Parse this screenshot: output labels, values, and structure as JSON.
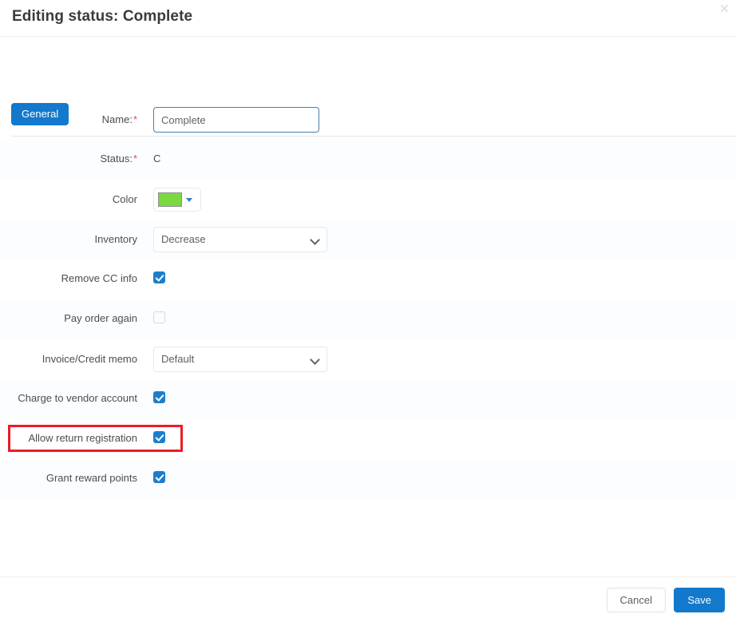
{
  "header": {
    "title": "Editing status: Complete",
    "close_label": "×"
  },
  "tabs": [
    {
      "label": "General",
      "active": true
    }
  ],
  "form": {
    "rows": [
      {
        "label": "Name:",
        "required": true,
        "type": "text",
        "value": "Complete",
        "placeholder": "Complete",
        "name": "name"
      },
      {
        "label": "Status:",
        "required": true,
        "type": "static",
        "value": "C",
        "name": "status"
      },
      {
        "label": "Color",
        "required": false,
        "type": "color",
        "value": "#7ad93f",
        "name": "color"
      },
      {
        "label": "Inventory",
        "required": false,
        "type": "select",
        "value": "Decrease",
        "name": "inventory"
      },
      {
        "label": "Remove CC info",
        "required": false,
        "type": "checkbox",
        "checked": true,
        "name": "remove-cc-info"
      },
      {
        "label": "Pay order again",
        "required": false,
        "type": "checkbox",
        "checked": false,
        "name": "pay-order-again"
      },
      {
        "label": "Invoice/Credit memo",
        "required": false,
        "type": "select",
        "value": "Default",
        "name": "invoice-credit-memo"
      },
      {
        "label": "Charge to vendor account",
        "required": false,
        "type": "checkbox",
        "checked": true,
        "name": "charge-to-vendor-account"
      },
      {
        "label": "Allow return registration",
        "required": false,
        "type": "checkbox",
        "checked": true,
        "name": "allow-return-registration",
        "highlighted": true
      },
      {
        "label": "Grant reward points",
        "required": false,
        "type": "checkbox",
        "checked": true,
        "name": "grant-reward-points"
      }
    ]
  },
  "footer": {
    "cancel_label": "Cancel",
    "save_label": "Save"
  },
  "colors": {
    "accent": "#1279cc",
    "required_star": "#e2447b",
    "highlight": "#ec1c24",
    "checkbox_on": "#1c7ecb",
    "swatch_green": "#7ad93f"
  }
}
